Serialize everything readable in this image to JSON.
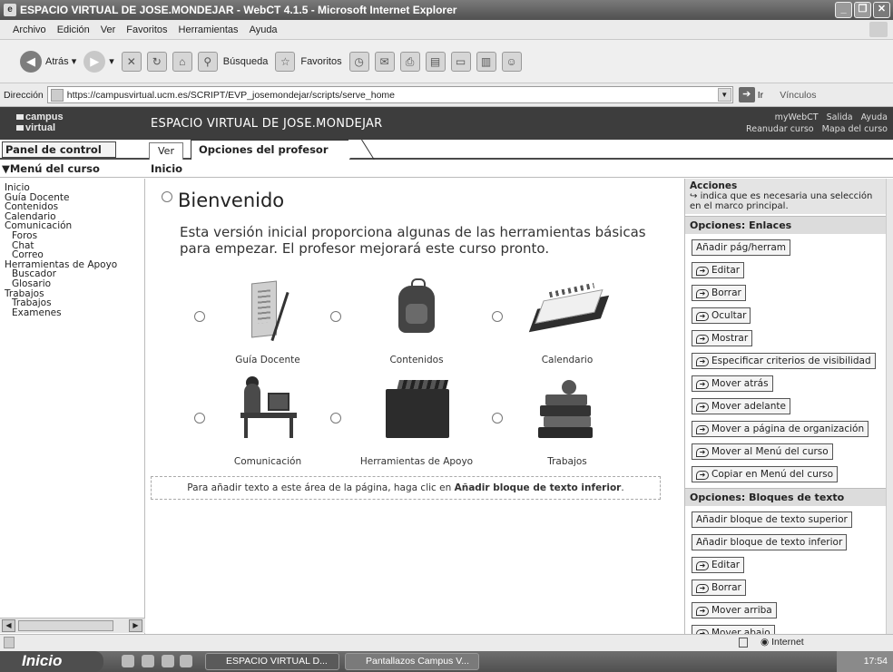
{
  "window": {
    "title": "ESPACIO VIRTUAL DE JOSE.MONDEJAR - WebCT 4.1.5 - Microsoft Internet Explorer"
  },
  "menubar": [
    "Archivo",
    "Edición",
    "Ver",
    "Favoritos",
    "Herramientas",
    "Ayuda"
  ],
  "toolbar": {
    "back": "Atrás",
    "search": "Búsqueda",
    "favorites": "Favoritos"
  },
  "address": {
    "label": "Dirección",
    "url": "https://campusvirtual.ucm.es/SCRIPT/EVP_josemondejar/scripts/serve_home",
    "go": "Ir",
    "links": "Vínculos"
  },
  "header": {
    "logo_line1": "campus",
    "logo_line2": "virtual",
    "course_title": "ESPACIO VIRTUAL DE JOSE.MONDEJAR",
    "links_row1": [
      "myWebCT",
      "Salida",
      "Ayuda"
    ],
    "links_row2": [
      "Reanudar curso",
      "Mapa del curso"
    ]
  },
  "tabs": {
    "panel": "Panel de control",
    "ver": "Ver",
    "opciones": "Opciones del profesor"
  },
  "subhead": {
    "menu_title": "Menú del curso",
    "breadcrumb": "Inicio"
  },
  "course_menu": [
    {
      "label": "Inicio",
      "sub": false
    },
    {
      "label": "Guía Docente",
      "sub": false
    },
    {
      "label": "Contenidos",
      "sub": false
    },
    {
      "label": "Calendario",
      "sub": false
    },
    {
      "label": "Comunicación",
      "sub": false
    },
    {
      "label": "Foros",
      "sub": true
    },
    {
      "label": "Chat",
      "sub": true
    },
    {
      "label": "Correo",
      "sub": true
    },
    {
      "label": "Herramientas de Apoyo",
      "sub": false
    },
    {
      "label": "Buscador",
      "sub": true
    },
    {
      "label": "Glosario",
      "sub": true
    },
    {
      "label": "Trabajos",
      "sub": false
    },
    {
      "label": "Trabajos",
      "sub": true
    },
    {
      "label": "Examenes",
      "sub": true
    }
  ],
  "main": {
    "welcome": "Bienvenido",
    "intro": "Esta versión inicial proporciona algunas de las herramientas básicas para empezar. El profesor mejorará este curso pronto.",
    "tools": [
      "Guía Docente",
      "Contenidos",
      "Calendario",
      "Comunicación",
      "Herramientas de Apoyo",
      "Trabajos"
    ],
    "note_prefix": "Para añadir texto a este área de la página, haga clic en ",
    "note_bold": "Añadir bloque de texto inferior",
    "note_suffix": "."
  },
  "actions": {
    "title": "Acciones",
    "hint": "indica que es necesaria una selección en el marco principal.",
    "links_title": "Opciones: Enlaces",
    "links": [
      {
        "label": "Añadir pág/herram",
        "arrow": false
      },
      {
        "label": "Editar",
        "arrow": true
      },
      {
        "label": "Borrar",
        "arrow": true
      },
      {
        "label": "Ocultar",
        "arrow": true
      },
      {
        "label": "Mostrar",
        "arrow": true
      },
      {
        "label": "Especificar criterios de visibilidad",
        "arrow": true
      },
      {
        "label": "Mover atrás",
        "arrow": true
      },
      {
        "label": "Mover adelante",
        "arrow": true
      },
      {
        "label": "Mover a página de organización",
        "arrow": true
      },
      {
        "label": "Mover al Menú del curso",
        "arrow": true
      },
      {
        "label": "Copiar en Menú del curso",
        "arrow": true
      }
    ],
    "blocks_title": "Opciones: Bloques de texto",
    "blocks": [
      {
        "label": "Añadir bloque de texto superior",
        "arrow": false
      },
      {
        "label": "Añadir bloque de texto inferior",
        "arrow": false
      },
      {
        "label": "Editar",
        "arrow": true
      },
      {
        "label": "Borrar",
        "arrow": true
      },
      {
        "label": "Mover arriba",
        "arrow": true
      },
      {
        "label": "Mover abajo",
        "arrow": true
      }
    ]
  },
  "status": {
    "zone": "Internet"
  },
  "taskbar": {
    "start": "Inicio",
    "tasks": [
      "ESPACIO VIRTUAL D...",
      "Pantallazos Campus V..."
    ],
    "clock": "17:54"
  }
}
